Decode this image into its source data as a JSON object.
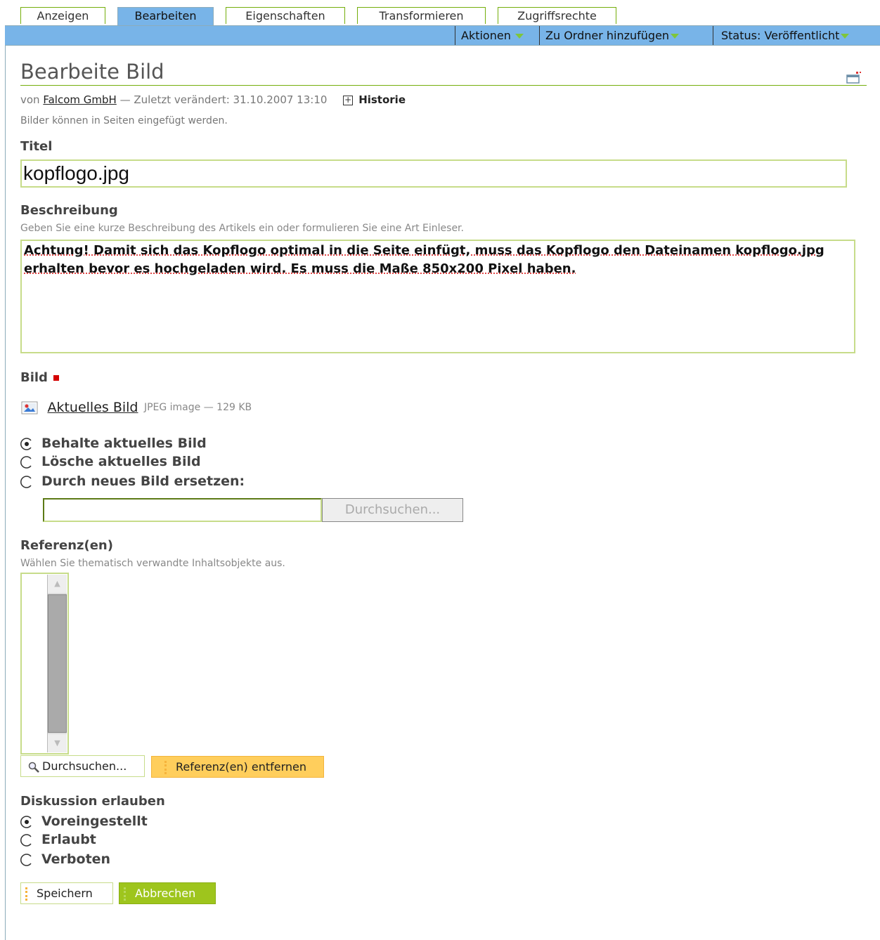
{
  "tabs": [
    "Anzeigen",
    "Bearbeiten",
    "Eigenschaften",
    "Transformieren",
    "Zugriffsrechte"
  ],
  "actions": {
    "aktionen": "Aktionen",
    "ordner": "Zu Ordner hinzufügen",
    "status": "Status: Veröffentlicht"
  },
  "page": {
    "title": "Bearbeite Bild",
    "by_prefix": "von",
    "author": "Falcom GmbH",
    "modified": "— Zuletzt verändert: 31.10.2007 13:10",
    "history": "Historie",
    "type_description": "Bilder können in Seiten eingefügt werden."
  },
  "fields": {
    "title_label": "Titel",
    "title_value": "kopflogo.jpg",
    "desc_label": "Beschreibung",
    "desc_help": "Geben Sie eine kurze Beschreibung des Artikels ein oder formulieren Sie eine Art Einleser.",
    "desc_value": "Achtung! Damit sich das Kopflogo optimal in die Seite einfügt, muss das Kopflogo den Dateinamen kopflogo.jpg erhalten bevor es hochgeladen wird. Es muss die Maße 850x200 Pixel haben.",
    "image_label": "Bild",
    "current_image_link": "Aktuelles Bild",
    "current_image_meta": "JPEG image — 129 KB",
    "image_options": [
      "Behalte aktuelles Bild",
      "Lösche aktuelles Bild",
      "Durch neues Bild ersetzen:"
    ],
    "browse_label": "Durchsuchen...",
    "ref_label": "Referenz(en)",
    "ref_help": "Wählen Sie thematisch verwandte Inhaltsobjekte aus.",
    "ref_browse": "Durchsuchen...",
    "ref_remove": "Referenz(en) entfernen",
    "discussion_label": "Diskussion erlauben",
    "discussion_options": [
      "Voreingestellt",
      "Erlaubt",
      "Verboten"
    ]
  },
  "buttons": {
    "save": "Speichern",
    "cancel": "Abbrechen"
  }
}
